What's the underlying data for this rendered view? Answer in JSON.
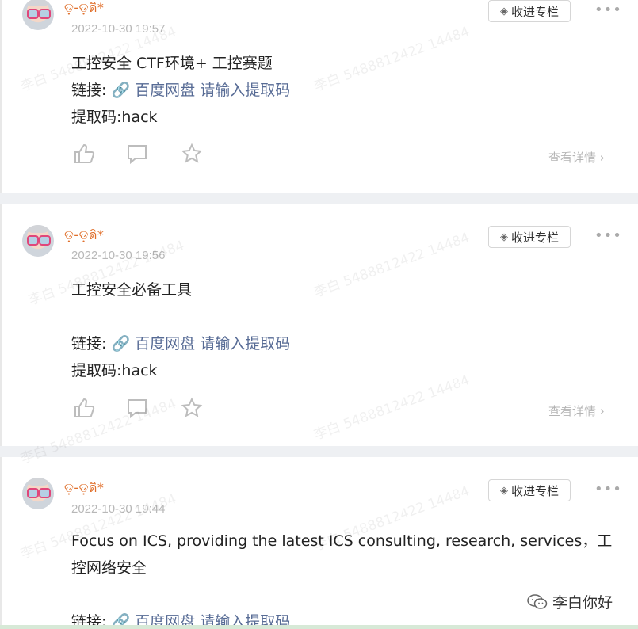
{
  "posts": [
    {
      "username": "ଡ଼-ଡ଼ดิ*",
      "timestamp": "2022-10-30 19:57",
      "content": [
        "工控安全 CTF环境+  工控赛题"
      ],
      "link_prefix": "链接:",
      "link_text": "百度网盘 请输入提取码",
      "code": "提取码:hack",
      "collect_label": "收进专栏",
      "more": "•••",
      "detail": "查看详情"
    },
    {
      "username": "ଡ଼-ଡ଼ดิ*",
      "timestamp": "2022-10-30 19:56",
      "content": [
        "工控安全必备工具"
      ],
      "link_prefix": "链接:",
      "link_text": "百度网盘 请输入提取码",
      "code": "提取码:hack",
      "collect_label": "收进专栏",
      "more": "•••",
      "detail": "查看详情"
    },
    {
      "username": "ଡ଼-ଡ଼ดิ*",
      "timestamp": "2022-10-30 19:44",
      "content": [
        "Focus on ICS, providing the latest ICS consulting, research, services，工控网络安全"
      ],
      "link_prefix": "链接:",
      "link_text": "百度网盘 请输入提取码",
      "collect_label": "收进专栏",
      "more": "•••"
    }
  ],
  "watermark": "李白 5488812422 14484",
  "brand": {
    "name": "李白你好",
    "icon": "wechat-icon"
  }
}
